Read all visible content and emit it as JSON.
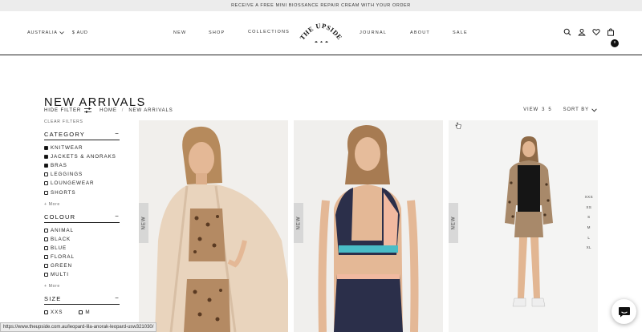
{
  "announcement": "RECEIVE A FREE MINI BIOSSANCE REPAIR CREAM WITH YOUR ORDER",
  "header": {
    "country": "AUSTRALIA",
    "currency": "$ AUD",
    "nav": [
      "NEW",
      "SHOP",
      "COLLECTIONS",
      "JOURNAL",
      "ABOUT",
      "SALE"
    ],
    "logo_text": "THE UPSIDE",
    "cart_count": "0"
  },
  "page": {
    "title": "NEW ARRIVALS",
    "hide_filter": "HIDE FILTER",
    "breadcrumbs": [
      "HOME",
      "NEW ARRIVALS"
    ],
    "crumb_sep": "/",
    "view_label": "VIEW",
    "view_options": [
      "3",
      "5"
    ],
    "sort_label": "SORT BY"
  },
  "filters": {
    "clear": "CLEAR FILTERS",
    "more": "+ More",
    "category": {
      "title": "CATEGORY",
      "toggle": "−",
      "options": [
        {
          "label": "KNITWEAR",
          "checked": true
        },
        {
          "label": "JACKETS & ANORAKS",
          "checked": true
        },
        {
          "label": "BRAS",
          "checked": true
        },
        {
          "label": "LEGGINGS",
          "checked": false
        },
        {
          "label": "LOUNGEWEAR",
          "checked": false
        },
        {
          "label": "SHORTS",
          "checked": false
        }
      ]
    },
    "colour": {
      "title": "COLOUR",
      "toggle": "−",
      "options": [
        {
          "label": "ANIMAL",
          "checked": false
        },
        {
          "label": "BLACK",
          "checked": false
        },
        {
          "label": "BLUE",
          "checked": false
        },
        {
          "label": "FLORAL",
          "checked": false
        },
        {
          "label": "GREEN",
          "checked": false
        },
        {
          "label": "MULTI",
          "checked": false
        }
      ]
    },
    "size": {
      "title": "SIZE",
      "toggle": "−",
      "options": [
        "XXS",
        "M"
      ]
    }
  },
  "products": {
    "new_tag": "NEW",
    "sizes": [
      "XXS",
      "XS",
      "S",
      "M",
      "L",
      "XL"
    ]
  },
  "status_url": "https://www.theupside.com.au/leopard-lila-anorak-leopard-usw321030/"
}
